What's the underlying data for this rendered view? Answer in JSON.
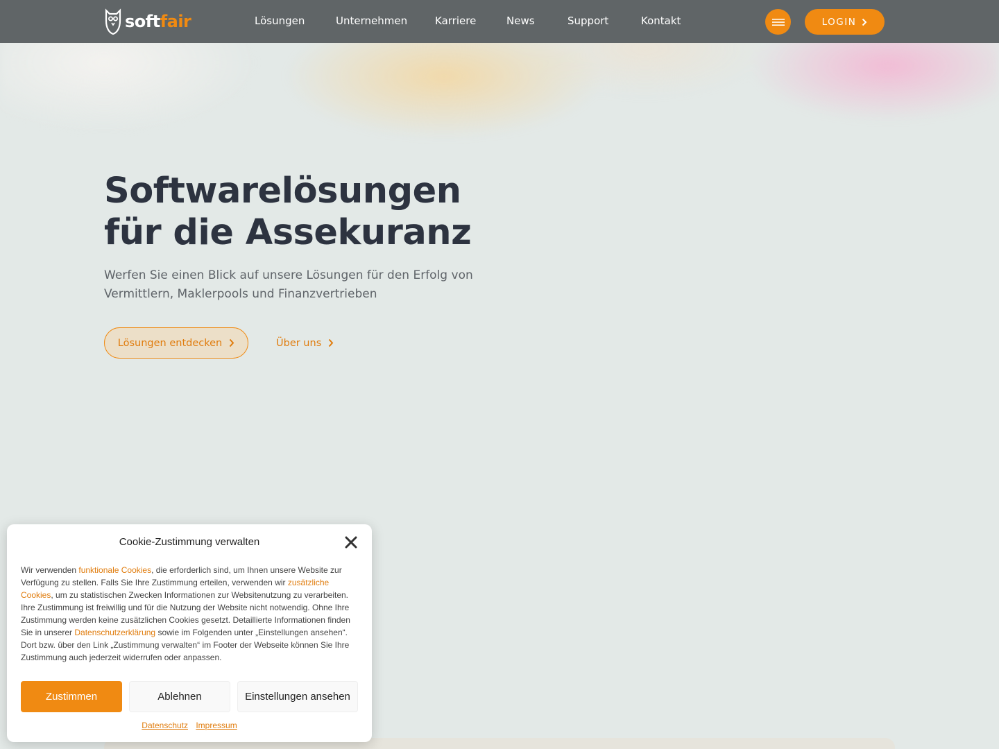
{
  "header": {
    "logo": {
      "part1": "soft",
      "part2": "fair"
    },
    "nav": [
      "Lösungen",
      "Unternehmen",
      "Karriere",
      "News",
      "Support",
      "Kontakt"
    ],
    "login_label": "LOGIN"
  },
  "hero": {
    "title_line1": "Softwarelösungen",
    "title_line2": "für die Assekuranz",
    "subtitle": "Werfen Sie einen Blick auf unsere Lösungen für den Erfolg von Vermittlern, Maklerpools und Finanzvertrieben",
    "primary_cta": "Lösungen entdecken",
    "secondary_cta": "Über uns"
  },
  "cookie": {
    "title": "Cookie-Zustimmung verwalten",
    "text": {
      "t1": "Wir verwenden ",
      "link1": "funktionale Cookies",
      "t2": ", die erforderlich sind, um Ihnen unsere Website zur Verfügung zu stellen. Falls Sie Ihre Zustimmung erteilen, verwenden wir ",
      "link2": "zusätzliche Cookies",
      "t3": ", um zu statistischen Zwecken Informationen zur Websitenutzung zu verarbeiten. Ihre Zustimmung ist freiwillig und für die Nutzung der Website nicht notwendig. Ohne Ihre Zustimmung werden keine zusätzlichen Cookies gesetzt. Detaillierte Informationen finden Sie in unserer ",
      "link3": "Datenschutzerklärung",
      "t4": " sowie im Folgenden unter „Einstellungen ansehen“. Dort bzw. über den Link „Zustimmung verwalten“ im Footer der Webseite können Sie Ihre Zustimmung auch jederzeit widerrufen oder anpassen."
    },
    "accept": "Zustimmen",
    "deny": "Ablehnen",
    "view_prefs": "Einstellungen ansehen",
    "links": [
      "Datenschutz",
      "Impressum"
    ]
  },
  "colors": {
    "accent": "#f08a12",
    "header_bg": "#606567",
    "page_bg": "#e3e9e7",
    "heading": "#2d3340"
  },
  "icons": {
    "menu": "hamburger-icon",
    "login_arrow": "chevron-right-icon",
    "close": "close-icon",
    "logo": "owl-icon"
  }
}
